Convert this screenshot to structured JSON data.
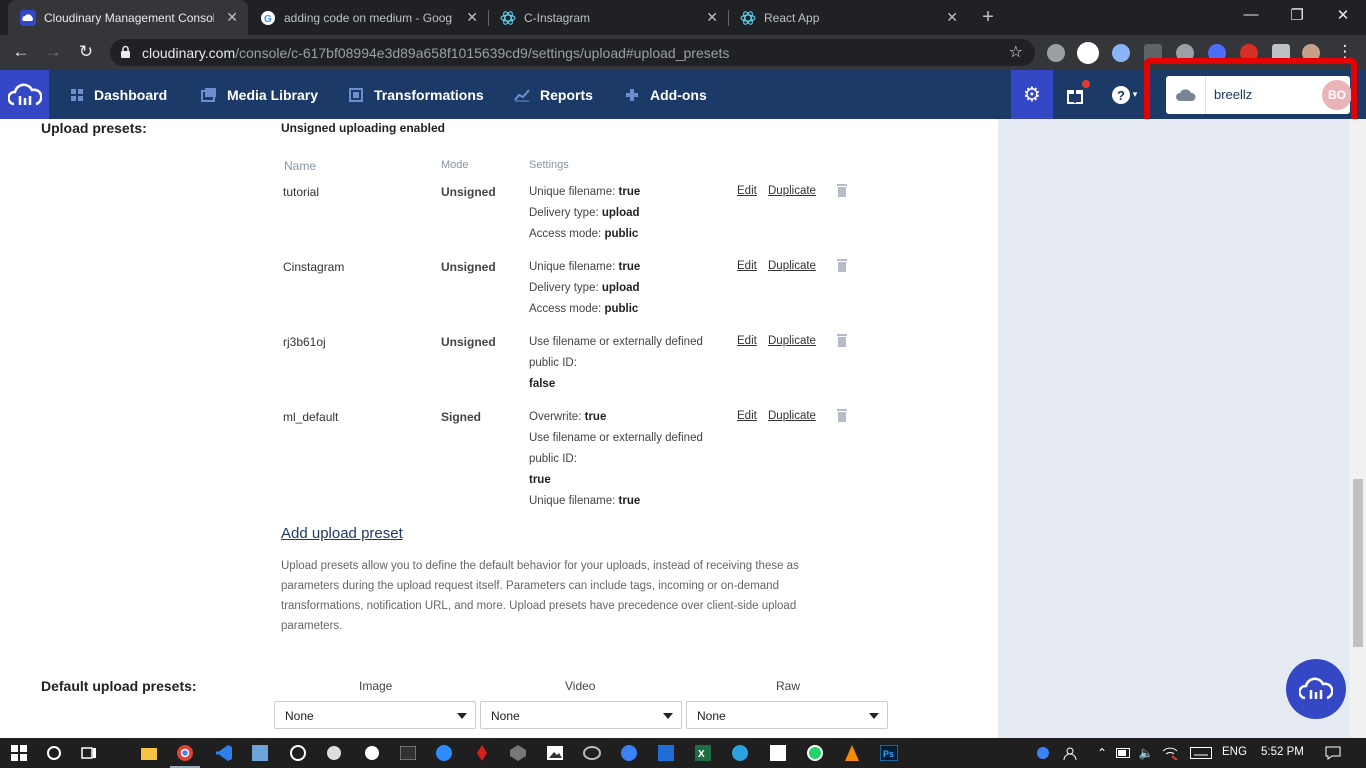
{
  "browser": {
    "tabs": [
      {
        "title": "Cloudinary Management Consol",
        "active": true
      },
      {
        "title": "adding code on medium - Goog",
        "active": false
      },
      {
        "title": "C-Instagram",
        "active": false
      },
      {
        "title": "React App",
        "active": false
      }
    ],
    "url_host": "cloudinary.com",
    "url_path": "/console/c-617bf08994e3d89a658f1015639cd9/settings/upload#upload_presets"
  },
  "header": {
    "nav": [
      {
        "label": "Dashboard",
        "icon": "dashboard-icon"
      },
      {
        "label": "Media Library",
        "icon": "media-library-icon"
      },
      {
        "label": "Transformations",
        "icon": "transformations-icon"
      },
      {
        "label": "Reports",
        "icon": "reports-icon"
      },
      {
        "label": "Add-ons",
        "icon": "addons-icon"
      }
    ],
    "account_name": "breellz",
    "avatar_initials": "BO"
  },
  "upload_presets": {
    "section_label": "Upload presets:",
    "status": "Unsigned uploading enabled",
    "columns": {
      "name": "Name",
      "mode": "Mode",
      "settings": "Settings"
    },
    "edit_label": "Edit",
    "duplicate_label": "Duplicate",
    "presets": [
      {
        "name": "tutorial",
        "mode": "Unsigned",
        "settings": [
          {
            "key": "Unique filename:",
            "value": "true"
          },
          {
            "key": "Delivery type:",
            "value": "upload"
          },
          {
            "key": "Access mode:",
            "value": "public"
          }
        ]
      },
      {
        "name": "Cinstagram",
        "mode": "Unsigned",
        "settings": [
          {
            "key": "Unique filename:",
            "value": "true"
          },
          {
            "key": "Delivery type:",
            "value": "upload"
          },
          {
            "key": "Access mode:",
            "value": "public"
          }
        ]
      },
      {
        "name": "rj3b61oj",
        "mode": "Unsigned",
        "settings": [
          {
            "key": "Use filename or externally defined",
            "value": ""
          },
          {
            "key": "public ID:",
            "value": ""
          },
          {
            "key": "",
            "value": "false"
          }
        ]
      },
      {
        "name": "ml_default",
        "mode": "Signed",
        "settings": [
          {
            "key": "Overwrite:",
            "value": "true"
          },
          {
            "key": "Use filename or externally defined",
            "value": ""
          },
          {
            "key": "public ID:",
            "value": ""
          },
          {
            "key": "",
            "value": "true"
          },
          {
            "key": "Unique filename:",
            "value": "true"
          }
        ]
      }
    ],
    "add_label": "Add upload preset",
    "description": "Upload presets allow you to define the default behavior for your uploads, instead of receiving these as parameters during the upload request itself. Parameters can include tags, incoming or on-demand transformations, notification URL, and more. Upload presets have precedence over client-side upload parameters."
  },
  "default_presets": {
    "section_label": "Default upload presets:",
    "columns": [
      {
        "label": "Image",
        "value": "None"
      },
      {
        "label": "Video",
        "value": "None"
      },
      {
        "label": "Raw",
        "value": "None"
      }
    ]
  },
  "taskbar": {
    "language": "ENG",
    "time": "5:52 PM"
  },
  "colors": {
    "header_bg": "#1c3a68",
    "brand_blue": "#3448c5",
    "highlight_red": "#e60000"
  }
}
